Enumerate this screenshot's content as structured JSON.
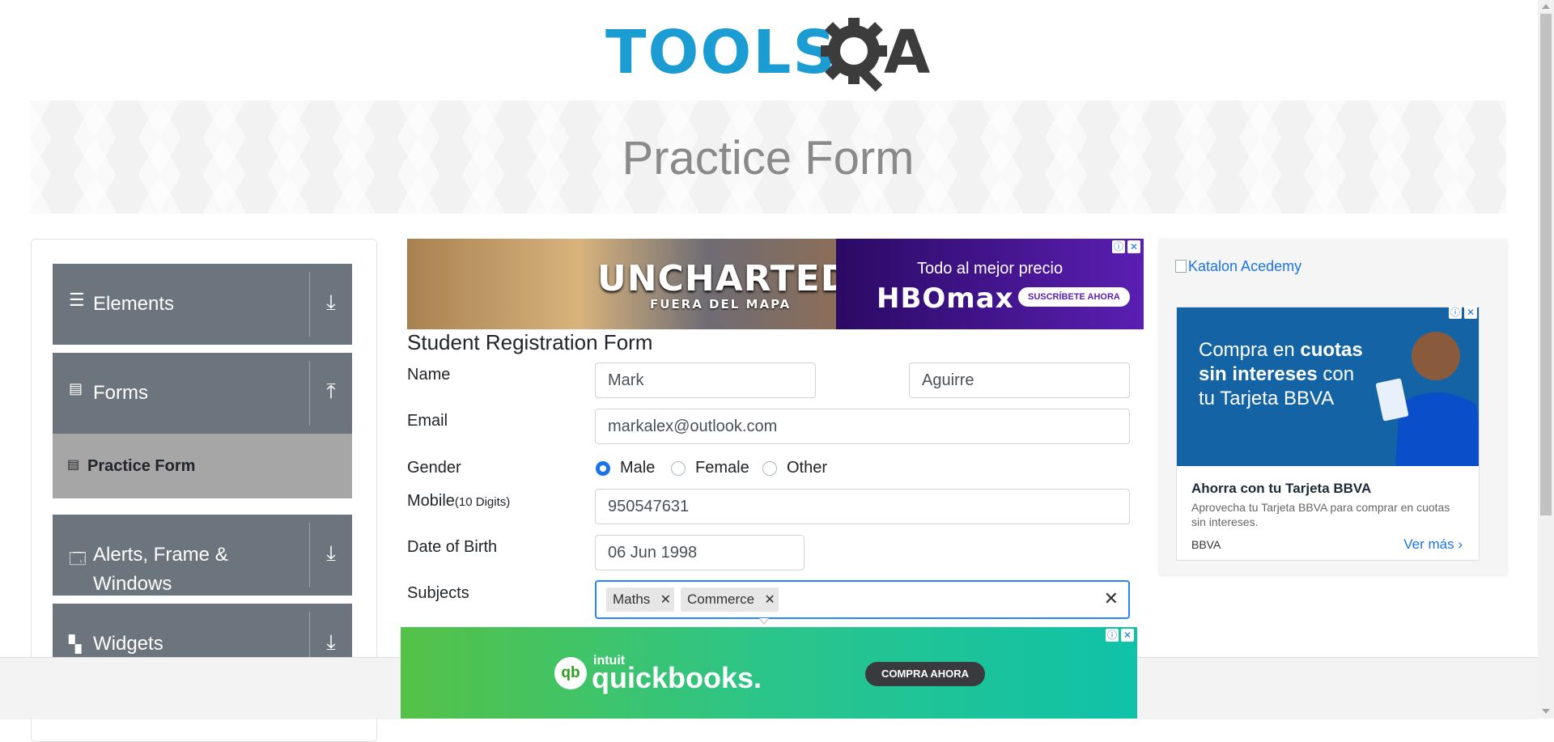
{
  "header": {
    "logo_text": "TOOLS",
    "logo_suffix": "A",
    "banner_title": "Practice Form"
  },
  "sidebar": {
    "groups": [
      {
        "label": "Elements",
        "icon": "hamburger-icon",
        "state": "collapsed"
      },
      {
        "label": "Forms",
        "icon": "document-icon",
        "state": "expanded"
      },
      {
        "label": "Alerts, Frame &",
        "label2": "Windows",
        "icon": "window-icon",
        "state": "collapsed"
      },
      {
        "label": "Widgets",
        "icon": "widgets-icon",
        "state": "collapsed"
      }
    ],
    "active_item": "Practice Form"
  },
  "ads": {
    "top": {
      "title": "UNCHARTED",
      "subtitle": "FUERA DEL MAPA",
      "tagline": "Todo al mejor precio",
      "brand": "HBOmax",
      "cta": "SUSCRÍBETE AHORA"
    },
    "right": {
      "broken_image_alt": "Katalon Acedemy",
      "headline_prefix": "Compra en ",
      "headline_bold": "cuotas sin intereses",
      "headline_rest": "con tu Tarjeta BBVA",
      "title": "Ahorra con tu Tarjeta BBVA",
      "body": "Aprovecha tu Tarjeta BBVA para comprar en cuotas sin intereses.",
      "brand": "BBVA",
      "cta": "Ver más"
    },
    "bottom": {
      "logo_mark": "qb",
      "maker": "intuit",
      "brand": "quickbooks.",
      "cta": "COMPRA AHORA"
    }
  },
  "form": {
    "title": "Student Registration Form",
    "name_label": "Name",
    "first_name": "Mark",
    "last_name": "Aguirre",
    "email_label": "Email",
    "email": "markalex@outlook.com",
    "gender_label": "Gender",
    "gender_options": [
      "Male",
      "Female",
      "Other"
    ],
    "gender_selected": "Male",
    "mobile_label": "Mobile",
    "mobile_hint": "(10 Digits)",
    "mobile": "950547631",
    "dob_label": "Date of Birth",
    "dob": "06 Jun 1998",
    "subjects_label": "Subjects",
    "subjects": [
      "Maths",
      "Commerce"
    ]
  },
  "colors": {
    "accent": "#1a73e8",
    "sidebar_group": "#6c757d",
    "sidebar_active": "#a6a6a6",
    "logo_blue": "#1b9cd2"
  }
}
